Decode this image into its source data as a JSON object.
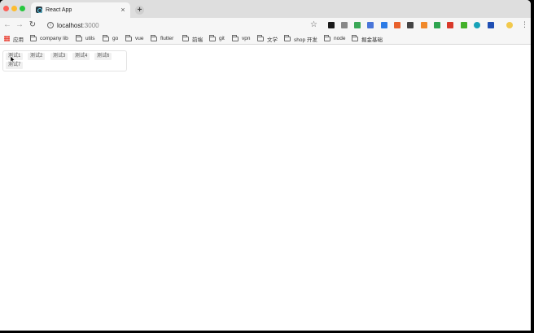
{
  "browser": {
    "tab_title": "React App",
    "tab_close": "×",
    "new_tab": "+",
    "url_host": "localhost",
    "url_port": ":3000"
  },
  "extensions": [
    {
      "name": "ext-black-icon",
      "color": "#1a1a1a"
    },
    {
      "name": "ext-a-icon",
      "color": "#888888"
    },
    {
      "name": "ext-green-grid-icon",
      "color": "#3aa757"
    },
    {
      "name": "ext-blue-s-icon",
      "color": "#4a76d9"
    },
    {
      "name": "ext-blue-square-icon",
      "color": "#2d7be5"
    },
    {
      "name": "ext-orange-icon",
      "color": "#e8612c"
    },
    {
      "name": "ext-qr-icon",
      "color": "#444444"
    },
    {
      "name": "ext-orange-square-icon",
      "color": "#f0892b"
    },
    {
      "name": "ext-green-shield-icon",
      "color": "#2ea44f"
    },
    {
      "name": "ext-red-icon",
      "color": "#d93a2b"
    },
    {
      "name": "ext-green-check-icon",
      "color": "#43b02a"
    },
    {
      "name": "ext-teal-circle-icon",
      "color": "#17a2b8"
    },
    {
      "name": "ext-blue-icon",
      "color": "#1f4fb4"
    },
    {
      "name": "profile-avatar-icon",
      "color": "#f2c94c"
    }
  ],
  "bookmarks": {
    "apps": "应用",
    "items": [
      "company lib",
      "utils",
      "go",
      "vue",
      "flutter",
      "前端",
      "git",
      "vpn",
      "文学",
      "shop 开发",
      "node",
      "掘金基础"
    ]
  },
  "tags": [
    "测试1",
    "测试2",
    "测试3",
    "测试4",
    "测试6",
    "测试7"
  ]
}
